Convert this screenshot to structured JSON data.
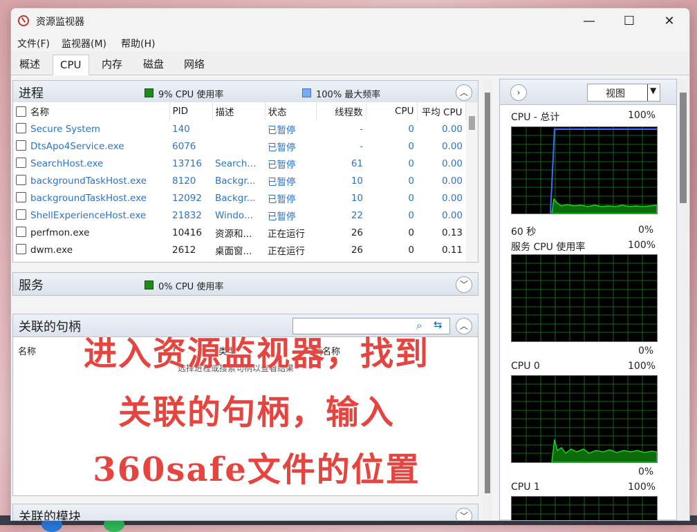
{
  "window": {
    "title": "资源监视器"
  },
  "controls": {
    "minimize": "—",
    "maximize": "☐",
    "close": "✕"
  },
  "menu": {
    "items": [
      "文件(F)",
      "监视器(M)",
      "帮助(H)"
    ]
  },
  "tabs": {
    "items": [
      "概述",
      "CPU",
      "内存",
      "磁盘",
      "网络"
    ],
    "active": "CPU"
  },
  "process": {
    "title": "进程",
    "cpu_usage": "9% CPU 使用率",
    "max_freq": "100% 最大频率",
    "columns": [
      "名称",
      "PID",
      "描述",
      "状态",
      "线程数",
      "CPU",
      "平均 CPU"
    ],
    "rows": [
      {
        "name": "Secure System",
        "pid": "140",
        "desc": "",
        "status": "已暂停",
        "threads": "-",
        "cpu": "0",
        "avg": "0.00",
        "suspended": true
      },
      {
        "name": "DtsApo4Service.exe",
        "pid": "6076",
        "desc": "",
        "status": "已暂停",
        "threads": "-",
        "cpu": "0",
        "avg": "0.00",
        "suspended": true
      },
      {
        "name": "SearchHost.exe",
        "pid": "13716",
        "desc": "Search...",
        "status": "已暂停",
        "threads": "61",
        "cpu": "0",
        "avg": "0.00",
        "suspended": true
      },
      {
        "name": "backgroundTaskHost.exe",
        "pid": "8120",
        "desc": "Backgr...",
        "status": "已暂停",
        "threads": "10",
        "cpu": "0",
        "avg": "0.00",
        "suspended": true
      },
      {
        "name": "backgroundTaskHost.exe",
        "pid": "12092",
        "desc": "Backgr...",
        "status": "已暂停",
        "threads": "10",
        "cpu": "0",
        "avg": "0.00",
        "suspended": true
      },
      {
        "name": "ShellExperienceHost.exe",
        "pid": "21832",
        "desc": "Windo...",
        "status": "已暂停",
        "threads": "22",
        "cpu": "0",
        "avg": "0.00",
        "suspended": true
      },
      {
        "name": "perfmon.exe",
        "pid": "10416",
        "desc": "资源和...",
        "status": "正在运行",
        "threads": "26",
        "cpu": "0",
        "avg": "0.13",
        "suspended": false
      },
      {
        "name": "dwm.exe",
        "pid": "2612",
        "desc": "桌面窗...",
        "status": "正在运行",
        "threads": "26",
        "cpu": "0",
        "avg": "0.11",
        "suspended": false
      }
    ]
  },
  "services": {
    "title": "服务",
    "cpu_usage": "0% CPU 使用率"
  },
  "handles": {
    "title": "关联的句柄",
    "search_value": "",
    "col_name": "名称",
    "col_pid": "PI",
    "col_type": "类型",
    "col_handle": "句柄名称",
    "hint": "选择进程或搜索句柄以查看结果"
  },
  "modules": {
    "title": "关联的模块"
  },
  "overlay": {
    "line1": "进入资源监视器，找到",
    "line2": "关联的句柄，输入",
    "line3": "360safe文件的位置"
  },
  "right": {
    "view_label": "视图",
    "graphs": [
      {
        "title": "CPU - 总计",
        "max": "100%",
        "bottom_left": "60 秒",
        "min": "0%"
      },
      {
        "title": "服务 CPU 使用率",
        "max": "100%",
        "bottom_left": "",
        "min": "0%"
      },
      {
        "title": "CPU 0",
        "max": "100%",
        "bottom_left": "",
        "min": "0%"
      },
      {
        "title": "CPU 1",
        "max": "100%",
        "bottom_left": "",
        "min": ""
      }
    ]
  },
  "colors": {
    "suspended_text": "#2b73c8",
    "graph_green": "#1fd21f",
    "graph_blue": "#3f6cff",
    "overlay_red": "#e6443e"
  }
}
